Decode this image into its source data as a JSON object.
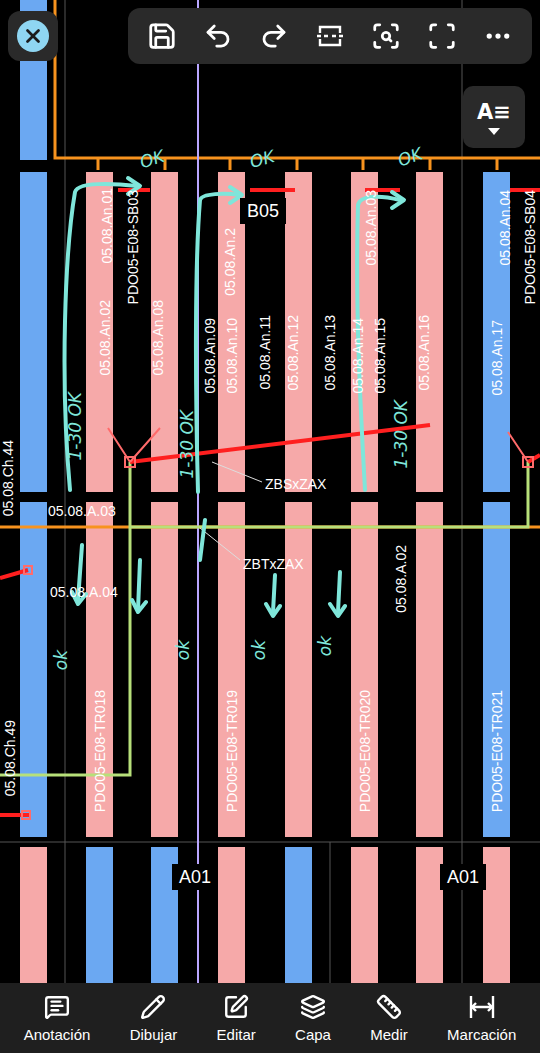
{
  "toolbar": {
    "text_style_button": {
      "label": "A≡"
    }
  },
  "canvas": {
    "top_bars": [
      {
        "color": "#6ba8f2"
      }
    ],
    "upper_bars": [
      {
        "color": "#6ba8f2"
      },
      {
        "color": "#f6a9a9"
      },
      {
        "color": "#f6a9a9"
      },
      {
        "color": "#f6a9a9"
      },
      {
        "color": "#f6a9a9"
      },
      {
        "color": "#f6a9a9"
      },
      {
        "color": "#f6a9a9"
      },
      {
        "color": "#6ba8f2"
      }
    ],
    "lower_bars": [
      {
        "color": "#6ba8f2"
      },
      {
        "color": "#f6a9a9"
      },
      {
        "color": "#f6a9a9"
      },
      {
        "color": "#f6a9a9"
      },
      {
        "color": "#f6a9a9"
      },
      {
        "color": "#f6a9a9"
      },
      {
        "color": "#f6a9a9"
      },
      {
        "color": "#6ba8f2"
      }
    ],
    "bottom_bars": [
      {
        "color": "#f6a9a9"
      },
      {
        "color": "#6ba8f2"
      },
      {
        "color": "#6ba8f2"
      },
      {
        "color": "#f6a9a9"
      },
      {
        "color": "#6ba8f2"
      },
      {
        "color": "#f6a9a9"
      },
      {
        "color": "#f6a9a9"
      },
      {
        "color": "#f6a9a9"
      }
    ],
    "labels": [
      {
        "text": "05.08.An.01",
        "vertical": true
      },
      {
        "text": "PDO05-E08-SB03",
        "vertical": true
      },
      {
        "text": "05.08.An.02",
        "vertical": true
      },
      {
        "text": "05.08.An.08",
        "vertical": true
      },
      {
        "text": "05.08.An.2",
        "vertical": true
      },
      {
        "text": "05.08.An.09",
        "vertical": true
      },
      {
        "text": "05.08.An.10",
        "vertical": true
      },
      {
        "text": "05.08.An.11",
        "vertical": true
      },
      {
        "text": "05.08.An.12",
        "vertical": true
      },
      {
        "text": "05.08.An.13",
        "vertical": true
      },
      {
        "text": "05.08.An.03",
        "vertical": true
      },
      {
        "text": "05.08.An.14",
        "vertical": true
      },
      {
        "text": "05.08.An.15",
        "vertical": true
      },
      {
        "text": "05.08.An.16",
        "vertical": true
      },
      {
        "text": "05.08.An.04",
        "vertical": true
      },
      {
        "text": "05.08.An.17",
        "vertical": true
      },
      {
        "text": "PDO05-E08-SB04",
        "vertical": true
      },
      {
        "text": "05.08.A.02",
        "vertical": true
      },
      {
        "text": "PDO05-E08-TR018",
        "vertical": true
      },
      {
        "text": "PDO05-E08-TR019",
        "vertical": true
      },
      {
        "text": "PDO05-E08-TR020",
        "vertical": true
      },
      {
        "text": "PDO05-E08-TR021",
        "vertical": true
      },
      {
        "text": "05.08.Ch.49",
        "vertical": true
      },
      {
        "text": "05.08.Ch.44",
        "vertical": true
      },
      {
        "text": "05.08.A.03",
        "vertical": false
      },
      {
        "text": "05.08.A.04",
        "vertical": false
      },
      {
        "text": "ZBSxZAX",
        "vertical": false
      },
      {
        "text": "ZBTxZAX",
        "vertical": false
      }
    ],
    "tags": [
      {
        "text": "B05"
      },
      {
        "text": "A01"
      },
      {
        "text": "A01"
      }
    ],
    "annotations": [
      {
        "text": "OK"
      },
      {
        "text": "OK"
      },
      {
        "text": "OK"
      },
      {
        "text": "1-30 OK"
      },
      {
        "text": "1-30 OK"
      },
      {
        "text": "1-30 OK"
      },
      {
        "text": "ok"
      },
      {
        "text": "ok"
      },
      {
        "text": "ok"
      },
      {
        "text": "ok"
      }
    ]
  },
  "bottom_bar": {
    "items": [
      {
        "label": "Anotación"
      },
      {
        "label": "Dibujar"
      },
      {
        "label": "Editar"
      },
      {
        "label": "Capa"
      },
      {
        "label": "Medir"
      },
      {
        "label": "Marcación"
      }
    ]
  }
}
